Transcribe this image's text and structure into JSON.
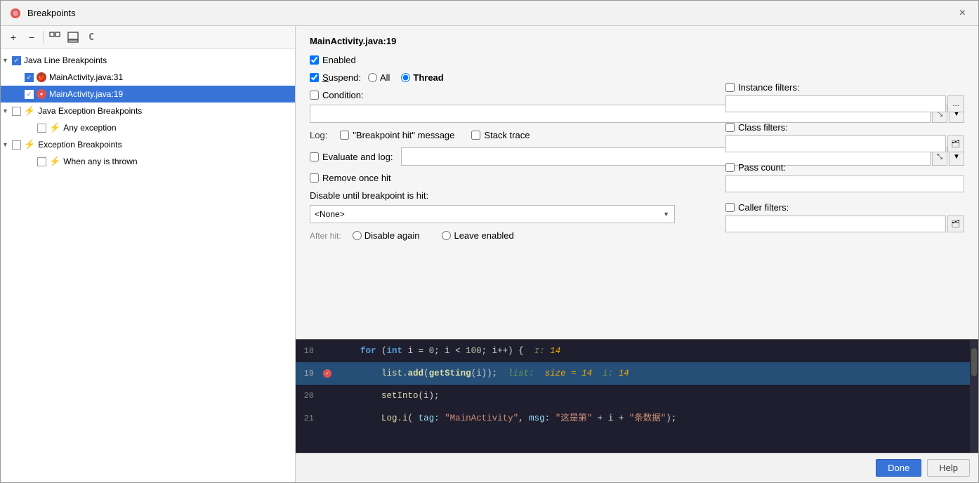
{
  "window": {
    "title": "Breakpoints",
    "close_label": "×"
  },
  "toolbar": {
    "add_label": "+",
    "remove_label": "−",
    "group_label": "⊞",
    "export_label": "⬆",
    "filter_label": "C"
  },
  "tree": {
    "items": [
      {
        "id": "java-line-group",
        "indent": 0,
        "label": "Java Line Breakpoints",
        "checked": true,
        "expanded": true,
        "type": "group",
        "icon": ""
      },
      {
        "id": "mainactivity-31",
        "indent": 1,
        "label": "MainActivity.java:31",
        "checked": true,
        "expanded": false,
        "type": "bp-red",
        "icon": "🍎"
      },
      {
        "id": "mainactivity-19",
        "indent": 1,
        "label": "MainActivity.java:19",
        "checked": true,
        "expanded": false,
        "type": "bp-red",
        "icon": "🔴",
        "selected": true
      },
      {
        "id": "java-exception-group",
        "indent": 0,
        "label": "Java Exception Breakpoints",
        "checked": false,
        "expanded": true,
        "type": "group",
        "icon": ""
      },
      {
        "id": "any-exception",
        "indent": 1,
        "label": "Any exception",
        "checked": false,
        "expanded": false,
        "type": "bp-lightning",
        "icon": "⚡"
      },
      {
        "id": "exception-group",
        "indent": 0,
        "label": "Exception Breakpoints",
        "checked": false,
        "expanded": true,
        "type": "group",
        "icon": ""
      },
      {
        "id": "when-any-thrown",
        "indent": 1,
        "label": "When any is thrown",
        "checked": false,
        "expanded": false,
        "type": "bp-lightning",
        "icon": "⚡"
      }
    ]
  },
  "detail": {
    "file_title": "MainActivity.java:19",
    "enabled_label": "Enabled",
    "suspend_label": "Suspend:",
    "all_label": "All",
    "thread_label": "Thread",
    "condition_label": "Condition:",
    "log_label": "Log:",
    "bp_hit_label": "\"Breakpoint hit\" message",
    "stack_trace_label": "Stack trace",
    "evaluate_label": "Evaluate and log:",
    "remove_once_hit_label": "Remove once hit",
    "disable_until_label": "Disable until breakpoint is hit:",
    "none_option": "<None>",
    "after_hit_label": "After hit:",
    "disable_again_label": "Disable again",
    "leave_enabled_label": "Leave enabled"
  },
  "filters": {
    "instance_label": "Instance filters:",
    "class_label": "Class filters:",
    "pass_count_label": "Pass count:",
    "caller_label": "Caller filters:"
  },
  "code": {
    "lines": [
      {
        "num": "18",
        "highlight": false,
        "has_bp": false,
        "content": "for_18"
      },
      {
        "num": "19",
        "highlight": true,
        "has_bp": true,
        "content": "list_19"
      },
      {
        "num": "20",
        "highlight": false,
        "has_bp": false,
        "content": "set_20"
      },
      {
        "num": "21",
        "highlight": false,
        "has_bp": false,
        "content": "log_21"
      }
    ]
  },
  "bottom": {
    "done_label": "Done",
    "help_label": "Help"
  }
}
